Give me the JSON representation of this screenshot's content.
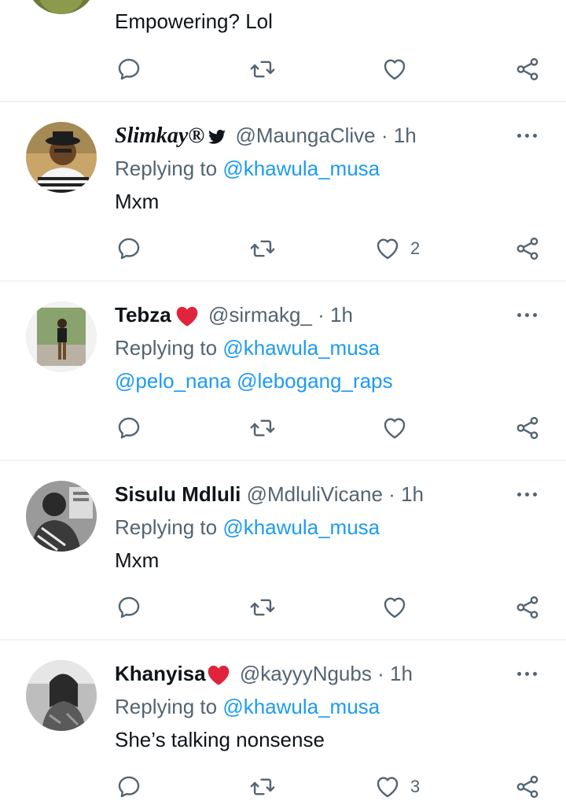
{
  "tweets": [
    {
      "body": "Empowering? Lol",
      "likes": ""
    },
    {
      "name": "Slimkay®",
      "handle": "@MaungaClive",
      "dot": "·",
      "time": "1h",
      "reply_prefix": "Replying to",
      "reply_to": "@khawula_musa",
      "body": "Mxm",
      "likes": "2"
    },
    {
      "name": "Tebza",
      "handle": "@sirmakg_",
      "dot": "·",
      "time": "1h",
      "reply_prefix": "Replying to",
      "reply_to": "@khawula_musa",
      "mention1": "@pelo_nana",
      "mention2": "@lebogang_raps",
      "likes": ""
    },
    {
      "name": "Sisulu Mdluli",
      "handle": "@MdluliVicane",
      "dot": "·",
      "time": "1h",
      "reply_prefix": "Replying to",
      "reply_to": "@khawula_musa",
      "body": "Mxm",
      "likes": ""
    },
    {
      "name": "Khanyisa",
      "handle": "@kayyyNgubs",
      "dot": "·",
      "time": "1h",
      "reply_prefix": "Replying to",
      "reply_to": "@khawula_musa",
      "body": "She’s talking nonsense",
      "likes": "3"
    }
  ],
  "icons": {
    "reply": "reply-icon",
    "retweet": "retweet-icon",
    "like": "heart-icon",
    "share": "share-icon",
    "more": "more-icon",
    "verified_bird": "twitter-bird-icon",
    "heart_emoji": "red-heart-icon"
  },
  "colors": {
    "link": "#1d9bf0",
    "secondary": "#536471",
    "divider": "#eff3f4",
    "heart_red": "#e0243c"
  }
}
